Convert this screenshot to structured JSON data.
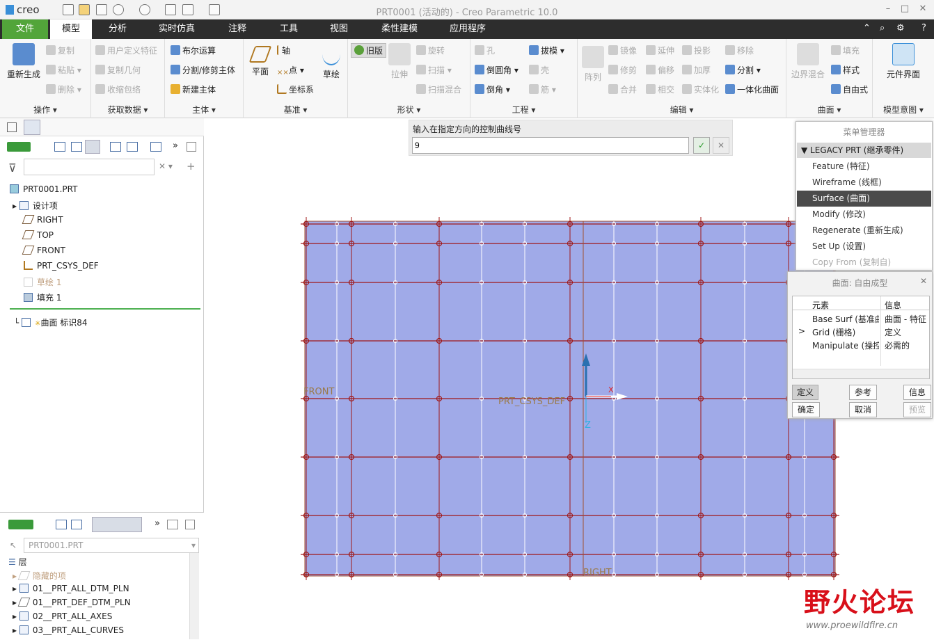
{
  "app": {
    "logo": "creo",
    "title": "PRT0001 (活动的) - Creo Parametric 10.0"
  },
  "menu": [
    "文件",
    "模型",
    "分析",
    "实时仿真",
    "注释",
    "工具",
    "视图",
    "柔性建模",
    "应用程序"
  ],
  "ribbon": {
    "ops": {
      "regen": "重新生成",
      "copy": "复制",
      "paste": "粘贴",
      "delete": "删除",
      "label": "操作"
    },
    "getdata": {
      "udf": "用户定义特征",
      "copygeom": "复制几何",
      "shrink": "收缩包络",
      "label": "获取数据"
    },
    "body": {
      "bool": "布尔运算",
      "split": "分割/修剪主体",
      "newbody": "新建主体",
      "label": "主体"
    },
    "datum": {
      "plane": "平面",
      "axis": "轴",
      "point": "点",
      "csys": "坐标系",
      "sketch": "草绘",
      "label": "基准"
    },
    "shapes": {
      "legacy": "旧版",
      "extrude": "拉伸",
      "revolve": "旋转",
      "sweep": "扫描",
      "blend": "扫描混合",
      "label": "形状"
    },
    "eng": {
      "hole": "孔",
      "round": "倒圆角",
      "chamfer": "倒角",
      "draft": "拔模",
      "shell": "壳",
      "rib": "筋",
      "label": "工程"
    },
    "edit": {
      "pattern": "阵列",
      "mirror": "镜像",
      "extend": "延伸",
      "project": "投影",
      "remove": "移除",
      "trim": "修剪",
      "offset": "偏移",
      "thicken": "加厚",
      "split": "分割",
      "merge": "合并",
      "intersect": "相交",
      "solidify": "实体化",
      "unify": "一体化曲面",
      "label": "编辑"
    },
    "surfaces": {
      "boundary": "边界混合",
      "fill": "填充",
      "style": "样式",
      "freeform": "自由式",
      "label": "曲面"
    },
    "intent": {
      "component": "元件界面",
      "label": "模型意图"
    }
  },
  "tree": {
    "items": [
      {
        "label": "PRT0001.PRT"
      },
      {
        "label": "设计项"
      },
      {
        "label": "RIGHT"
      },
      {
        "label": "TOP"
      },
      {
        "label": "FRONT"
      },
      {
        "label": "PRT_CSYS_DEF"
      },
      {
        "label": "草绘 1"
      },
      {
        "label": "填充 1"
      },
      {
        "label": "曲面 标识84"
      }
    ]
  },
  "layers": {
    "model": "PRT0001.PRT",
    "root": "层",
    "items": [
      {
        "label": "隐藏的项"
      },
      {
        "label": "01__PRT_ALL_DTM_PLN"
      },
      {
        "label": "01__PRT_DEF_DTM_PLN"
      },
      {
        "label": "02__PRT_ALL_AXES"
      },
      {
        "label": "03__PRT_ALL_CURVES"
      }
    ]
  },
  "prompt": {
    "text": "输入在指定方向的控制曲线号",
    "value": "9"
  },
  "graphics": {
    "front": "FRONT",
    "right": "RIGHT",
    "csys": "PRT_CSYS_DEF",
    "x": "X",
    "z": "Z",
    "surface_color": "#a0aae8"
  },
  "menumgr": {
    "title": "菜单管理器",
    "header": "LEGACY PRT (继承零件)",
    "items": [
      {
        "label": "Feature (特征)"
      },
      {
        "label": "Wireframe (线框)"
      },
      {
        "label": "Surface (曲面)"
      },
      {
        "label": "Modify (修改)"
      },
      {
        "label": "Regenerate (重新生成)"
      },
      {
        "label": "Set Up (设置)"
      },
      {
        "label": "Copy From (复制自)"
      }
    ]
  },
  "dialog": {
    "title": "曲面: 自由成型",
    "col1": "元素",
    "col2": "信息",
    "rows": [
      {
        "el": "Base Surf (基准曲",
        "info": "曲面 - 特征"
      },
      {
        "el": "Grid (栅格)",
        "info": "定义",
        "marker": ">"
      },
      {
        "el": "Manipulate (操控",
        "info": "必需的"
      }
    ],
    "define": "定义",
    "ref": "参考",
    "info": "信息",
    "ok": "确定",
    "cancel": "取消",
    "preview": "预览"
  },
  "watermark": {
    "text": "野火论坛",
    "url": "www.proewildfire.cn"
  }
}
